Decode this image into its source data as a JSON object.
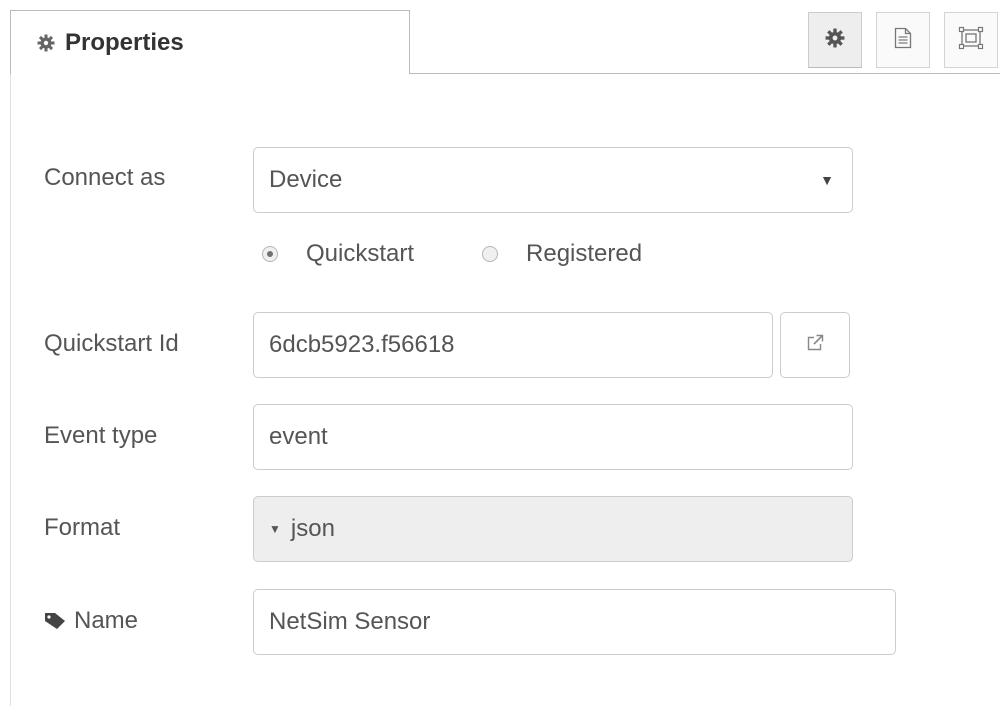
{
  "tabs": {
    "properties_label": "Properties"
  },
  "toolbar": {
    "icons": [
      "gear-icon",
      "document-icon",
      "frame-icon"
    ]
  },
  "form": {
    "connect_as": {
      "label": "Connect as",
      "value": "Device"
    },
    "auth": {
      "option1": "Quickstart",
      "option2": "Registered",
      "selected": "Quickstart"
    },
    "quickstart_id": {
      "label": "Quickstart Id",
      "value": "6dcb5923.f56618"
    },
    "event_type": {
      "label": "Event type",
      "value": "event"
    },
    "format": {
      "label": "Format",
      "value": "json"
    },
    "name": {
      "label": "Name",
      "value": "NetSim Sensor"
    }
  },
  "colors": {
    "border": "#cccccc",
    "disabled_bg": "#eeeeee",
    "text": "#555555"
  }
}
